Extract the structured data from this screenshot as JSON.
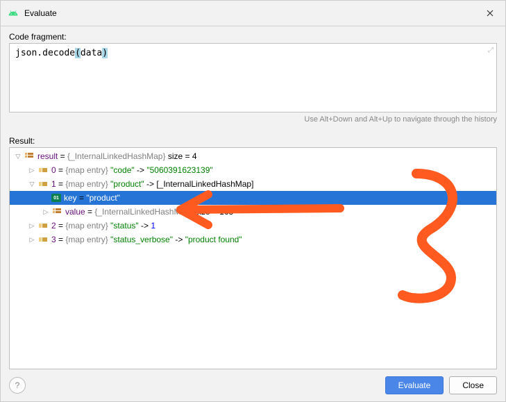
{
  "titlebar": {
    "title": "Evaluate"
  },
  "labels": {
    "code_fragment": "Code fragment:",
    "result": "Result:",
    "hint": "Use Alt+Down and Alt+Up to navigate through the history"
  },
  "code": {
    "expr_prefix": "json.decode",
    "expr_open": "(",
    "expr_arg": "data",
    "expr_close": ")"
  },
  "tree": {
    "root": {
      "name": "result",
      "type": "{_InternalLinkedHashMap}",
      "size_label": "size = 4"
    },
    "entries": [
      {
        "index": "0",
        "tag": "{map entry}",
        "key": "\"code\"",
        "arrow": "->",
        "value": "\"5060391623139\""
      },
      {
        "index": "1",
        "tag": "{map entry}",
        "key": "\"product\"",
        "arrow": "->",
        "value": "[_InternalLinkedHashMap]",
        "expanded": true,
        "child_key": {
          "name": "key",
          "value": "\"product\""
        },
        "child_value": {
          "name": "value",
          "type": "{_InternalLinkedHashMap}",
          "size_label": "size = 163"
        }
      },
      {
        "index": "2",
        "tag": "{map entry}",
        "key": "\"status\"",
        "arrow": "->",
        "value": "1"
      },
      {
        "index": "3",
        "tag": "{map entry}",
        "key": "\"status_verbose\"",
        "arrow": "->",
        "value": "\"product found\""
      }
    ]
  },
  "buttons": {
    "evaluate": "Evaluate",
    "close": "Close"
  }
}
